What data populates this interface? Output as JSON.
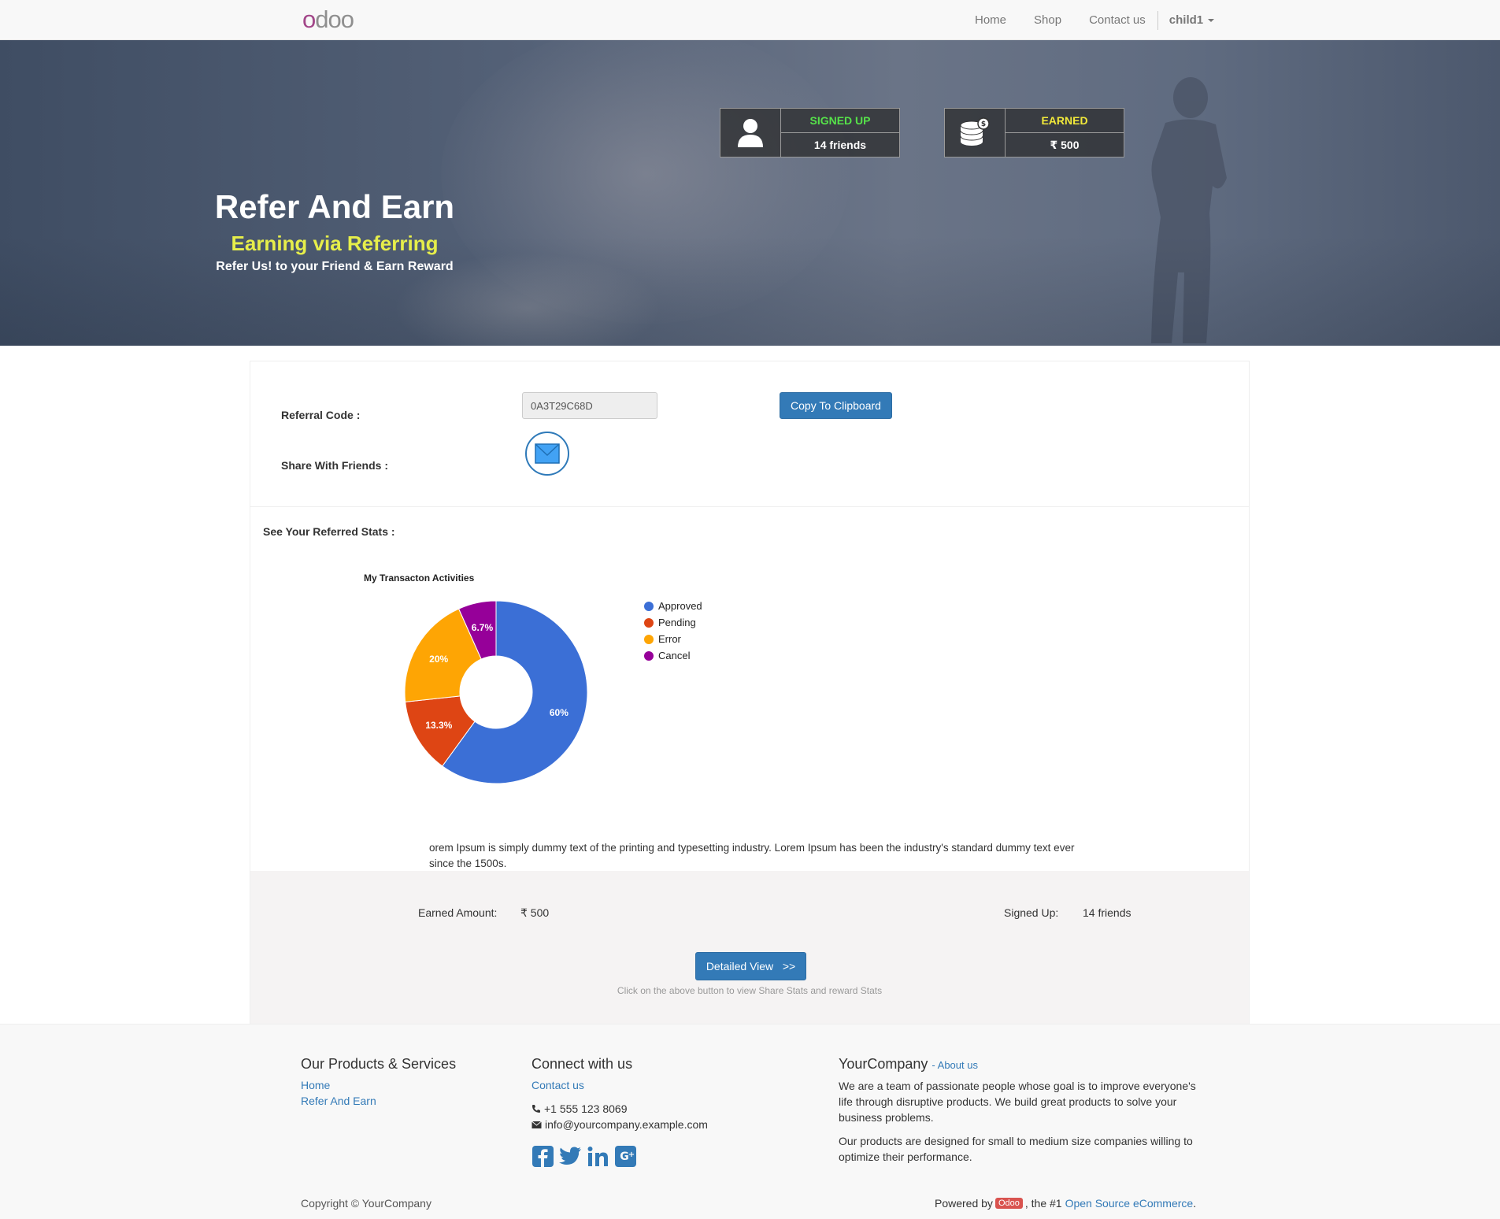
{
  "navbar": {
    "logo": "odoo",
    "links": [
      "Home",
      "Shop",
      "Contact us"
    ],
    "user": "child1"
  },
  "hero": {
    "title": "Refer And Earn",
    "subtitle": "Earning via Referring",
    "tagline": "Refer Us! to your Friend & Earn Reward",
    "signed_up": {
      "label": "SIGNED UP",
      "value": "14 friends",
      "icon": "user-icon"
    },
    "earned": {
      "label": "EARNED",
      "value": "₹ 500",
      "icon": "coins-icon"
    },
    "colors": {
      "signed_up_label": "#56e24a",
      "earned_label": "#f2ea3a",
      "subtitle": "#e6ee4a"
    }
  },
  "referral": {
    "code_label": "Referral Code :",
    "code_value": "0A3T29C68D",
    "copy_button": "Copy To Clipboard",
    "share_label": "Share With Friends :",
    "share_icon": "envelope-icon"
  },
  "stats": {
    "title": "See Your Referred Stats :"
  },
  "chart_data": {
    "type": "pie",
    "title": "My Transacton Activities",
    "categories": [
      "Approved",
      "Pending",
      "Error",
      "Cancel"
    ],
    "values": [
      60,
      13.3,
      20,
      6.7
    ],
    "labels": [
      "60%",
      "13.3%",
      "20%",
      "6.7%"
    ],
    "colors": [
      "#3b6fd6",
      "#de4514",
      "#fea504",
      "#960099"
    ],
    "donut": true,
    "legend_position": "right"
  },
  "description": "orem Ipsum is simply dummy text of the printing and typesetting industry. Lorem Ipsum has been the industry's standard dummy text ever since the 1500s.",
  "summary": {
    "earned_label": "Earned Amount:",
    "earned_value": "₹ 500",
    "signed_label": "Signed Up:",
    "signed_value": "14 friends",
    "detail_button": "Detailed View   >>",
    "hint": "Click on the above button to view Share Stats and reward Stats"
  },
  "footer": {
    "products_title": "Our Products & Services",
    "products_links": [
      "Home",
      "Refer And Earn"
    ],
    "connect_title": "Connect with us",
    "contact_link": "Contact us",
    "phone": "+1 555 123 8069",
    "email": "info@yourcompany.example.com",
    "social_icons": [
      "facebook-icon",
      "twitter-icon",
      "linkedin-icon",
      "google-plus-icon"
    ],
    "company_name": "YourCompany",
    "about_link": "- About us",
    "about_p1": "We are a team of passionate people whose goal is to improve everyone's life through disruptive products. We build great products to solve your business problems.",
    "about_p2": "Our products are designed for small to medium size companies willing to optimize their performance.",
    "copyright": "Copyright © YourCompany",
    "powered_by": "Powered by",
    "odoo_badge": "Odoo",
    "powered_mid": ", the #1",
    "powered_link": "Open Source eCommerce",
    "powered_end": "."
  },
  "brand_colors": {
    "primary": "#337ab7",
    "logo_accent": "#a24689"
  }
}
